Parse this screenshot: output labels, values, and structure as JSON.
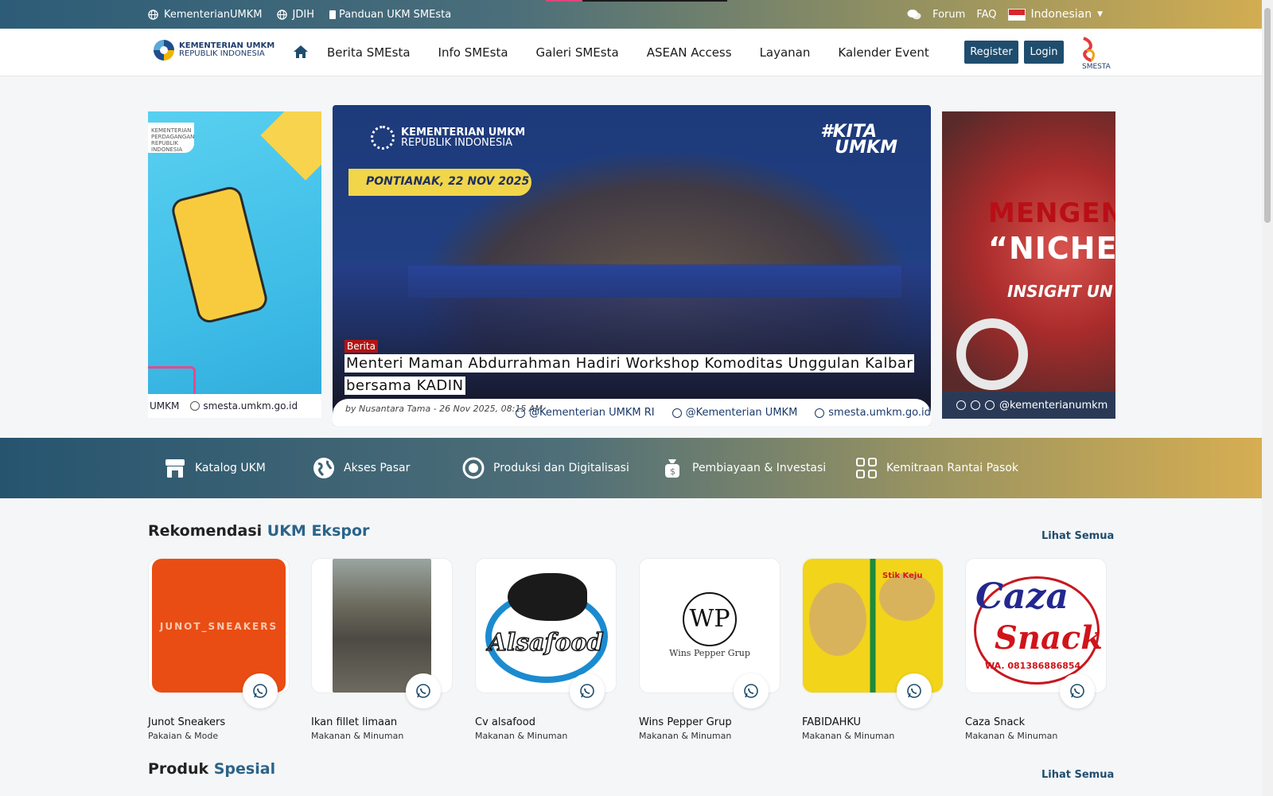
{
  "topbar": {
    "left": [
      "KementerianUMKM",
      "JDIH",
      "Panduan UKM SMEsta"
    ],
    "forum": "Forum",
    "faq": "FAQ",
    "language": "Indonesian"
  },
  "nav": {
    "logo_line1": "KEMENTERIAN UMKM",
    "logo_line2": "REPUBLIK INDONESIA",
    "menu": [
      "Berita SMEsta",
      "Info SMEsta",
      "Galeri SMEsta",
      "ASEAN Access",
      "Layanan",
      "Kalender Event"
    ],
    "register": "Register",
    "login": "Login",
    "brand": "SMESTA"
  },
  "carousel": {
    "left": {
      "tag": "KEMENTERIAN PERDAGANGAN REPUBLIK INDONESIA",
      "foot_a": "UMKM",
      "foot_b": "smesta.umkm.go.id"
    },
    "main": {
      "org_line1": "KEMENTERIAN UMKM",
      "org_line2": "REPUBLIK INDONESIA",
      "hashtag_1": "#KITA",
      "hashtag_2": "UMKM",
      "location": "PONTIANAK, 22 NOV 2025",
      "category": "Berita",
      "headline_1": "Menteri Maman Abdurrahman Hadiri Workshop Komoditas Unggulan Kalbar",
      "headline_2": "bersama KADIN",
      "byline": "by Nusantara Tama - 26 Nov 2025, 08:15 AM",
      "social": [
        "@Kementerian UMKM RI",
        "@Kementerian UMKM",
        "smesta.umkm.go.id"
      ]
    },
    "right": {
      "line1": "MENGEN",
      "line2": "“NICHE",
      "line3": "INSIGHT UN",
      "handle": "@kementerianumkm"
    }
  },
  "services": [
    "Katalog UKM",
    "Akses Pasar",
    "Produksi dan Digitalisasi",
    "Pembiayaan & Investasi",
    "Kemitraan Rantai Pasok"
  ],
  "section1": {
    "title_plain": "Rekomendasi",
    "title_accent": "UKM Ekspor",
    "see_all": "Lihat Semua",
    "cards": [
      {
        "name": "Junot Sneakers",
        "category": "Pakaian & Mode",
        "img_text": "JUNOT_SNEAKERS"
      },
      {
        "name": "Ikan fillet limaan",
        "category": "Makanan & Minuman",
        "img_text": ""
      },
      {
        "name": "Cv alsafood",
        "category": "Makanan & Minuman",
        "img_text": "Alsafood"
      },
      {
        "name": "Wins Pepper Grup",
        "category": "Makanan & Minuman",
        "img_text": "Wins Pepper Grup"
      },
      {
        "name": "FABIDAHKU",
        "category": "Makanan & Minuman",
        "img_text": "Stik Keju"
      },
      {
        "name": "Caza Snack",
        "category": "Makanan & Minuman",
        "img_text": "Caza",
        "img_text2": "Snack",
        "img_text3": "WA. 081386886854"
      }
    ]
  },
  "section2": {
    "title_plain": "Produk",
    "title_accent": "Spesial",
    "see_all": "Lihat Semua"
  },
  "colors": {
    "brand_dark": "#1f4d6e",
    "accent_gold": "#d6ae52",
    "badge_red": "#b31313"
  }
}
